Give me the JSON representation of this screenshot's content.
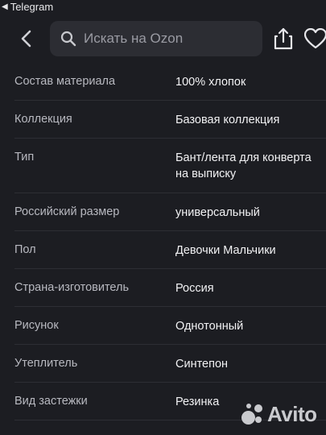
{
  "status_bar": {
    "back_app_label": "Telegram"
  },
  "header": {
    "search_placeholder": "Искать на Ozon"
  },
  "specs": [
    {
      "label": "Состав материала",
      "value": "100% хлопок"
    },
    {
      "label": "Коллекция",
      "value": "Базовая коллекция"
    },
    {
      "label": "Тип",
      "value": "Бант/лента для конверта на выписку"
    },
    {
      "label": "Российский размер",
      "value": "универсальный"
    },
    {
      "label": "Пол",
      "value": "Девочки Мальчики"
    },
    {
      "label": "Страна-изготовитель",
      "value": "Россия"
    },
    {
      "label": "Рисунок",
      "value": "Однотонный"
    },
    {
      "label": "Утеплитель",
      "value": "Синтепон"
    },
    {
      "label": "Вид застежки",
      "value": "Резинка"
    }
  ],
  "watermark": {
    "brand": "Avito"
  },
  "colors": {
    "background": "#1c1d22",
    "search_bg": "#2c2d33",
    "label": "#b8b9c0",
    "value": "#f2f2f4",
    "separator": "#2d2e34"
  }
}
